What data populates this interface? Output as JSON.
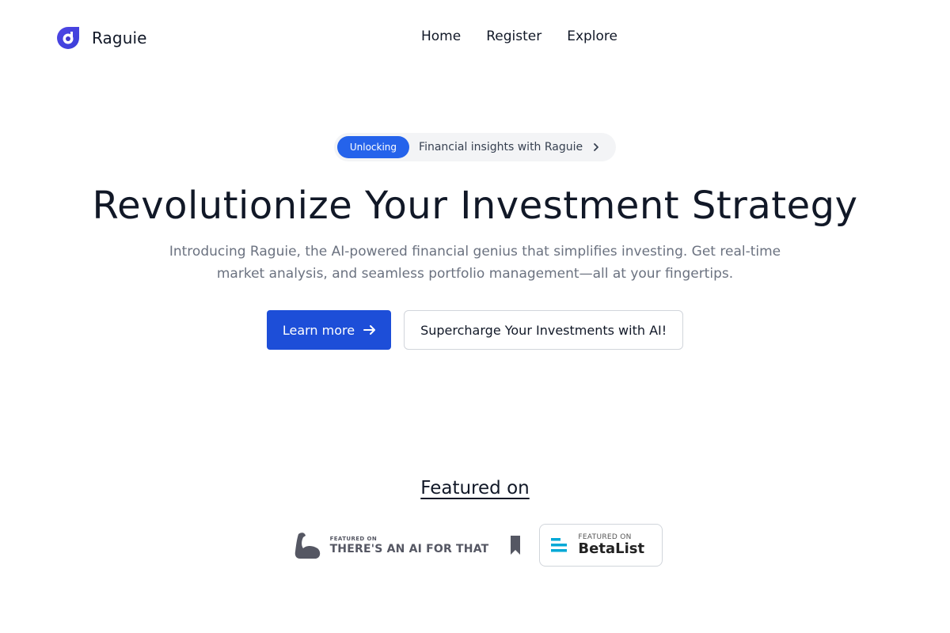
{
  "brand": {
    "name": "Raguie",
    "logo_icon": "droplet-logo-icon",
    "accent_color": "#4338ca"
  },
  "nav": {
    "links": [
      {
        "label": "Home"
      },
      {
        "label": "Register"
      },
      {
        "label": "Explore"
      }
    ]
  },
  "hero": {
    "pill": {
      "badge": "Unlocking",
      "text": "Financial insights with Raguie",
      "icon": "chevron-right-icon"
    },
    "headline": "Revolutionize Your Investment Strategy",
    "subtitle": "Introducing Raguie, the AI-powered financial genius that simplifies investing. Get real-time market analysis, and seamless portfolio management—all at your fingertips.",
    "primary_cta": {
      "label": "Learn more",
      "icon": "arrow-right-icon"
    },
    "secondary_cta": {
      "label": "Supercharge Your Investments with AI!"
    },
    "primary_color": "#1d4ed8"
  },
  "featured": {
    "title": "Featured on",
    "badges": [
      {
        "small": "FEATURED ON",
        "big": "THERE'S AN AI FOR THAT",
        "icon": "flexed-arm-icon",
        "extra_icon": "bookmark-icon"
      },
      {
        "small": "FEATURED ON",
        "big": "BetaList",
        "icon": "betalist-bars-icon",
        "icon_color": "#00b4d8"
      }
    ]
  }
}
